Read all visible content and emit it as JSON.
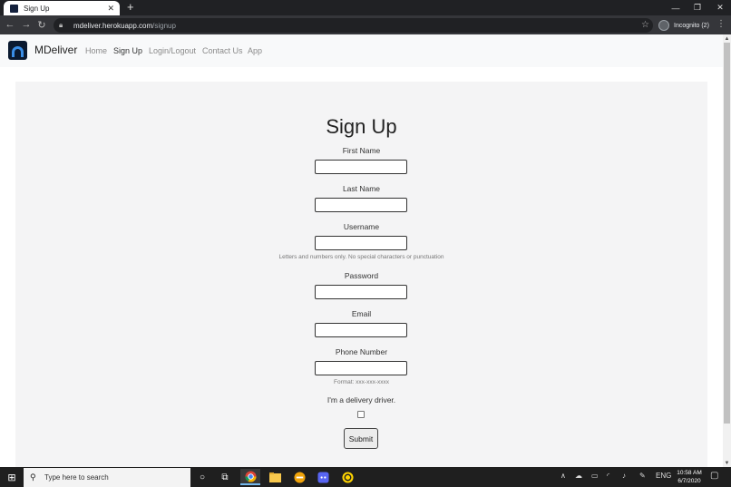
{
  "browser": {
    "tab_title": "Sign Up",
    "url_host": "mdeliver.herokuapp.com",
    "url_path": "/signup",
    "incognito_label": "Incognito (2)"
  },
  "site": {
    "brand": "MDeliver",
    "nav": [
      {
        "label": "Home",
        "active": false
      },
      {
        "label": "Sign Up",
        "active": true
      },
      {
        "label": "Login/Logout",
        "active": false
      },
      {
        "label": "Contact Us",
        "active": false
      },
      {
        "label": "App",
        "active": false
      }
    ]
  },
  "form": {
    "title": "Sign Up",
    "first_name_label": "First Name",
    "last_name_label": "Last Name",
    "username_label": "Username",
    "username_help": "Letters and numbers only. No special characters or punctuation",
    "password_label": "Password",
    "email_label": "Email",
    "phone_label": "Phone Number",
    "phone_help": "Format: xxx-xxx-xxxx",
    "driver_label": "I'm a delivery driver.",
    "submit_label": "Submit"
  },
  "taskbar": {
    "search_placeholder": "Type here to search",
    "language": "ENG",
    "time": "10:58 AM",
    "date": "6/7/2020"
  },
  "colors": {
    "brand_logo_bg": "#0b1a30",
    "brand_logo_accent": "#3a8ee6",
    "navbar_bg": "#f8f9fa",
    "jumbotron_bg": "#f4f4f5"
  }
}
